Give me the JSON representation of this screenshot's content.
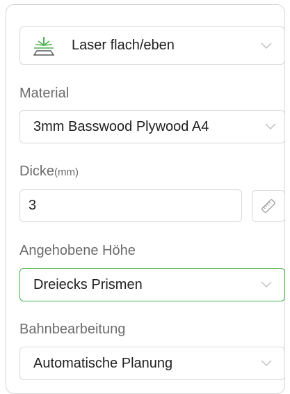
{
  "mode_select": {
    "value": "Laser flach/eben",
    "icon": "laser-beam-icon",
    "accent": "#4caf50"
  },
  "material": {
    "label": "Material",
    "value": "3mm Basswood Plywood A4"
  },
  "thickness": {
    "label": "Dicke",
    "unit": "(mm)",
    "value": "3",
    "measure_icon": "ruler-icon"
  },
  "raised_height": {
    "label": "Angehobene Höhe",
    "value": "Dreiecks Prismen",
    "border_color": "#3fae49"
  },
  "path_processing": {
    "label": "Bahnbearbeitung",
    "value": "Automatische Planung"
  }
}
